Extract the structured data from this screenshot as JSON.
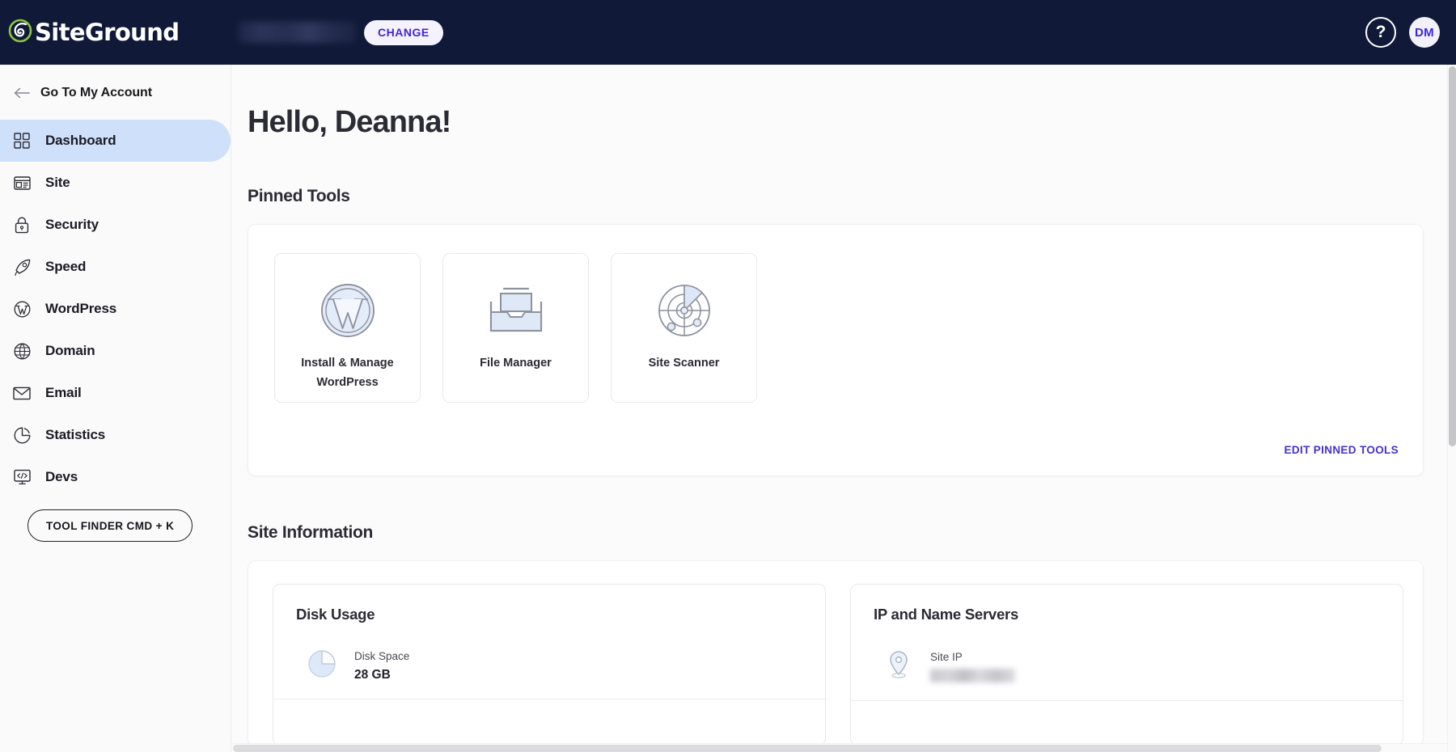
{
  "brand": {
    "name": "SiteGround",
    "logo_icon": "siteground-spiral-logo",
    "accent_indigo": "#4026d9",
    "header_bg": "#101a38",
    "active_nav_bg": "#cfe0fb"
  },
  "topbar": {
    "site_name_value": "",
    "site_name_masked": true,
    "change_label": "CHANGE",
    "help_icon": "question-mark-circle-icon",
    "help_label": "?",
    "avatar_initials": "DM"
  },
  "sidebar": {
    "back_link": {
      "label": "Go To My Account",
      "icon": "arrow-left-icon"
    },
    "items": [
      {
        "label": "Dashboard",
        "icon": "grid-squares-icon",
        "active": true
      },
      {
        "label": "Site",
        "icon": "browser-layout-icon",
        "active": false
      },
      {
        "label": "Security",
        "icon": "padlock-icon",
        "active": false
      },
      {
        "label": "Speed",
        "icon": "rocket-icon",
        "active": false
      },
      {
        "label": "WordPress",
        "icon": "wordpress-icon",
        "active": false
      },
      {
        "label": "Domain",
        "icon": "globe-icon",
        "active": false
      },
      {
        "label": "Email",
        "icon": "envelope-icon",
        "active": false
      },
      {
        "label": "Statistics",
        "icon": "pie-chart-icon",
        "active": false
      },
      {
        "label": "Devs",
        "icon": "code-monitor-icon",
        "active": false
      }
    ],
    "tool_finder_label": "TOOL FINDER CMD + K"
  },
  "main": {
    "greeting": "Hello, Deanna!",
    "pinned_section_title": "Pinned Tools",
    "pinned_tools": [
      {
        "label": "Install & Manage WordPress",
        "icon": "wordpress-logo-icon"
      },
      {
        "label": "File Manager",
        "icon": "file-tray-icon"
      },
      {
        "label": "Site Scanner",
        "icon": "radar-scanner-icon"
      }
    ],
    "edit_pinned_label": "EDIT PINNED TOOLS",
    "site_info_section_title": "Site Information",
    "info_cards": [
      {
        "title": "Disk Usage",
        "rows": [
          {
            "icon": "pie-chart-icon",
            "label": "Disk Space",
            "value": "28 GB",
            "masked": false
          }
        ]
      },
      {
        "title": "IP and Name Servers",
        "rows": [
          {
            "icon": "location-pin-icon",
            "label": "Site IP",
            "value": "",
            "masked": true
          }
        ]
      }
    ]
  }
}
